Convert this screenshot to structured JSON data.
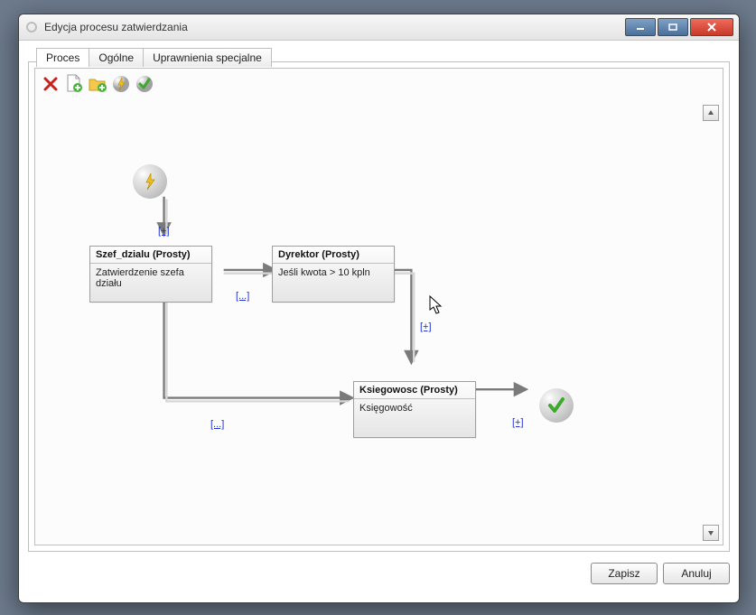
{
  "window": {
    "title": "Edycja procesu zatwierdzania"
  },
  "tabs": [
    "Proces",
    "Ogólne",
    "Uprawnienia specjalne"
  ],
  "toolbar": {
    "delete": "delete-icon",
    "add_doc": "document-add-icon",
    "add_folder": "folder-add-icon",
    "start": "lightning-icon",
    "finish": "check-icon"
  },
  "nodes": {
    "n1": {
      "title": "Szef_dzialu (Prosty)",
      "body": "Zatwierdzenie szefa działu"
    },
    "n2": {
      "title": "Dyrektor (Prosty)",
      "body": "Jeśli kwota > 10 kpln"
    },
    "n3": {
      "title": "Ksiegowosc (Prosty)",
      "body": "Księgowość"
    }
  },
  "links": {
    "plus": "[+]",
    "dots": "[...]"
  },
  "buttons": {
    "save": "Zapisz",
    "cancel": "Anuluj"
  }
}
